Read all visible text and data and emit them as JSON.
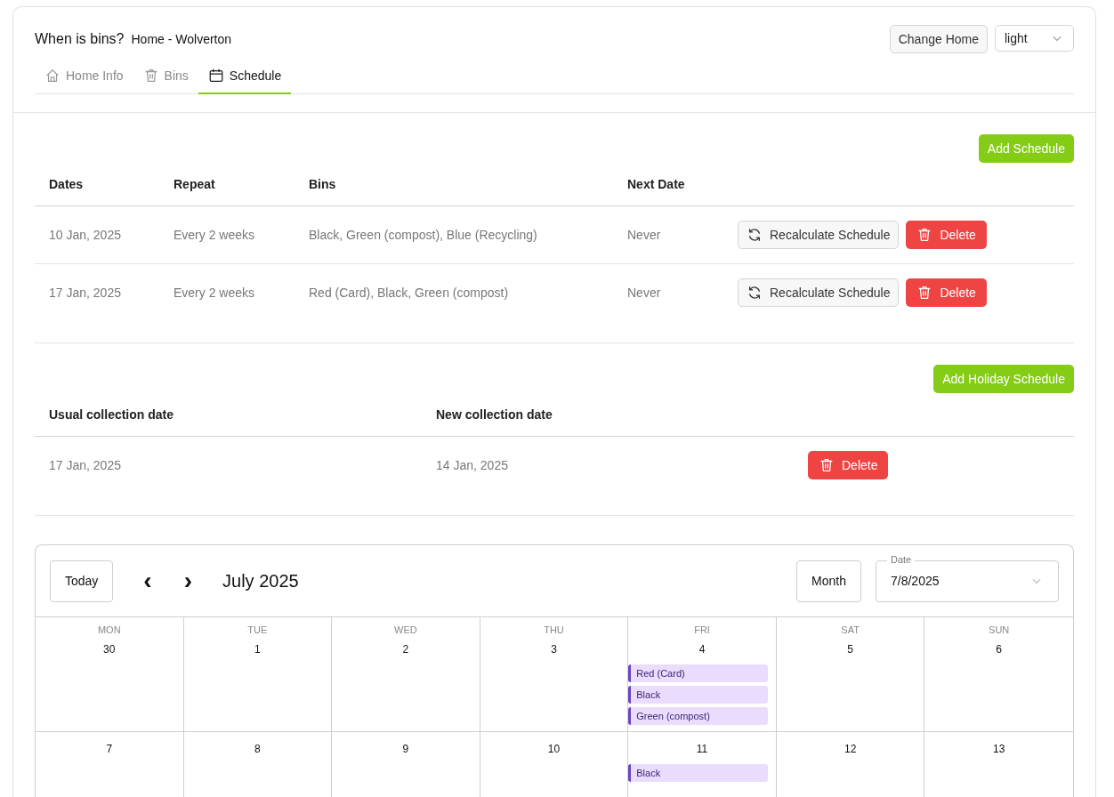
{
  "header": {
    "title": "When is bins?",
    "home": "Home - Wolverton",
    "change_home": "Change Home",
    "theme": "light"
  },
  "tabs": [
    {
      "label": "Home Info",
      "kind": "home",
      "selected": false
    },
    {
      "label": "Bins",
      "kind": "trash",
      "selected": false
    },
    {
      "label": "Schedule",
      "kind": "calendar",
      "selected": true
    }
  ],
  "schedules": {
    "add_button": "Add Schedule",
    "columns": [
      "Dates",
      "Repeat",
      "Bins",
      "Next Date"
    ],
    "rows": [
      {
        "dates": "10 Jan, 2025",
        "repeat": "Every 2 weeks",
        "bins": "Black, Green (compost), Blue (Recycling)",
        "next_date": "Never",
        "recalculate": "Recalculate Schedule",
        "delete": "Delete"
      },
      {
        "dates": "17 Jan, 2025",
        "repeat": "Every 2 weeks",
        "bins": "Red (Card), Black, Green (compost)",
        "next_date": "Never",
        "recalculate": "Recalculate Schedule",
        "delete": "Delete"
      }
    ]
  },
  "holidays": {
    "add_button": "Add Holiday Schedule",
    "columns": [
      "Usual collection date",
      "New collection date"
    ],
    "rows": [
      {
        "usual": "17 Jan, 2025",
        "new": "14 Jan, 2025",
        "delete": "Delete"
      }
    ]
  },
  "calendar": {
    "today": "Today",
    "prev": "‹",
    "next": "›",
    "month_label": "July 2025",
    "view": "Month",
    "date_field": {
      "label": "Date",
      "value": "7/8/2025"
    },
    "weekdays": [
      "MON",
      "TUE",
      "WED",
      "THU",
      "FRI",
      "SAT",
      "SUN"
    ],
    "weeks": [
      [
        {
          "day": "30"
        },
        {
          "day": "1"
        },
        {
          "day": "2"
        },
        {
          "day": "3"
        },
        {
          "day": "4",
          "events": [
            "Red (Card)",
            "Black",
            "Green (compost)"
          ]
        },
        {
          "day": "5"
        },
        {
          "day": "6"
        }
      ],
      [
        {
          "day": "7"
        },
        {
          "day": "8"
        },
        {
          "day": "9"
        },
        {
          "day": "10"
        },
        {
          "day": "11",
          "events": [
            "Black"
          ]
        },
        {
          "day": "12"
        },
        {
          "day": "13"
        }
      ]
    ]
  }
}
